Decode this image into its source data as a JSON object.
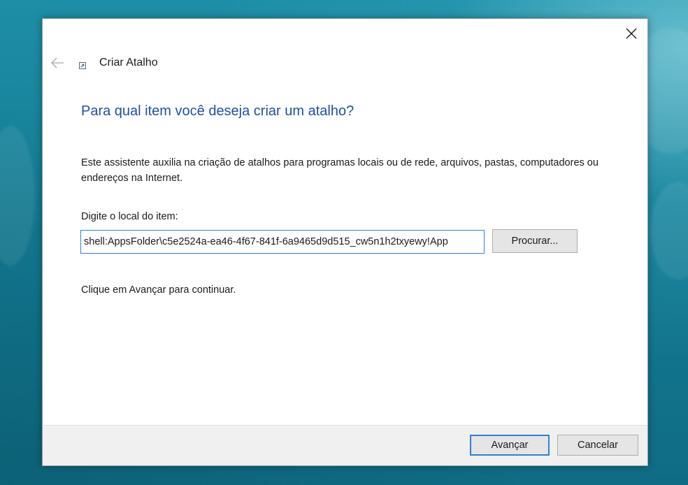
{
  "wizard": {
    "title": "Criar Atalho",
    "heading": "Para qual item você deseja criar um atalho?",
    "description": "Este assistente auxilia na criação de atalhos para programas locais ou de rede, arquivos, pastas, computadores ou endereços na Internet.",
    "location_label": "Digite o local do item:",
    "location_value": "shell:AppsFolder\\c5e2524a-ea46-4f67-841f-6a9465d9d515_cw5n1h2txyewy!App",
    "browse_label": "Procurar...",
    "continue_hint": "Clique em Avançar para continuar."
  },
  "footer": {
    "next_label": "Avançar",
    "cancel_label": "Cancelar"
  },
  "icons": {
    "close": "close-icon",
    "back": "back-arrow-icon",
    "shortcut": "shortcut-icon"
  },
  "colors": {
    "heading": "#1f4fa5",
    "focus_border": "#2f7fd6",
    "button_face": "#e5e5e5",
    "footer_bg": "#f0f0f0"
  }
}
